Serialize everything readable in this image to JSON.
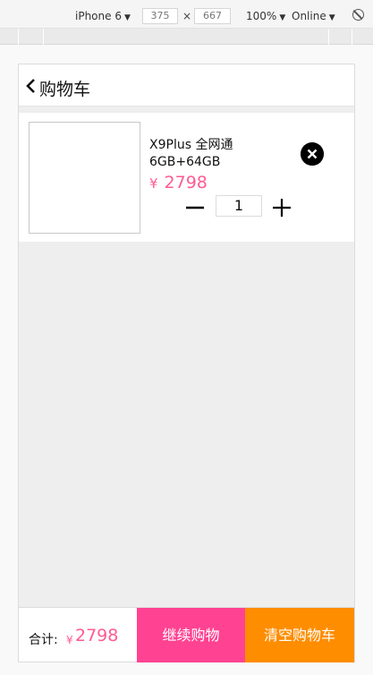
{
  "devtools": {
    "device": "iPhone 6",
    "width": "375",
    "times": "×",
    "height": "667",
    "zoom": "100%",
    "network": "Online"
  },
  "header": {
    "title": "购物车"
  },
  "cart": {
    "items": [
      {
        "name": "X9Plus 全网通 6GB+64GB",
        "currency": "¥",
        "price": "2798",
        "quantity": "1"
      }
    ]
  },
  "footer": {
    "total_label": "合计:",
    "currency": "¥",
    "total": "2798",
    "continue_label": "继续购物",
    "clear_label": "清空购物车"
  },
  "colors": {
    "price_pink": "#ff5b92",
    "continue_bg": "#ff4392",
    "clear_bg": "#ff8d00",
    "page_bg": "#eeeeee"
  }
}
